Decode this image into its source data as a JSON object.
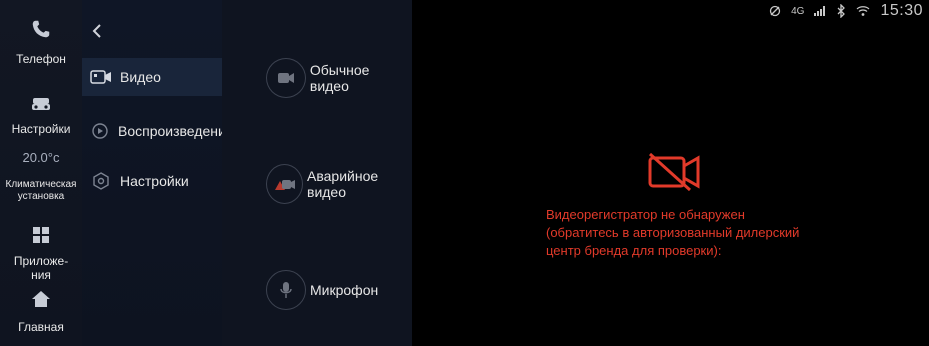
{
  "sidebar": {
    "phone_label": "Телефон",
    "settings_label": "Настройки",
    "temperature": "20.0°c",
    "climate_label_line1": "Климатическая",
    "climate_label_line2": "установка",
    "apps_label_line1": "Приложе-",
    "apps_label_line2": "ния",
    "home_label": "Главная"
  },
  "menu": {
    "items": [
      {
        "label": "Видео"
      },
      {
        "label": "Воспроизведение"
      },
      {
        "label": "Настройки"
      }
    ]
  },
  "modes": {
    "items": [
      {
        "label": "Обычное видео"
      },
      {
        "label": "Аварийное видео"
      },
      {
        "label": "Микрофон"
      }
    ]
  },
  "video": {
    "message_line1": "Видеорегистратор не обнаружен",
    "message_line2": "(обратитесь в авторизованный дилерский",
    "message_line3": "центр бренда для проверки):",
    "error_color": "#e23a2a"
  },
  "status": {
    "network": "4G",
    "time": "15:30"
  }
}
